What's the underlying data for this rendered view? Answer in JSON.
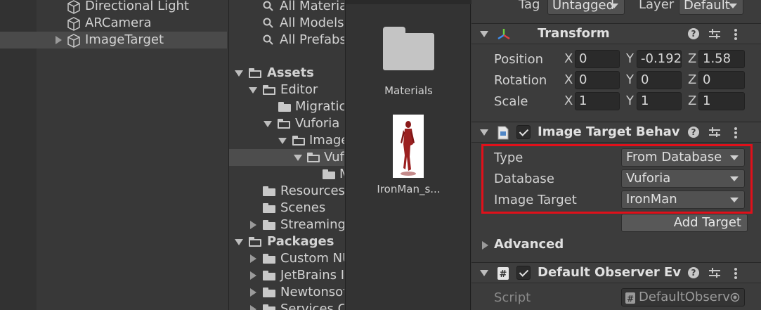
{
  "hierarchy": {
    "items": [
      {
        "label": "Directional Light"
      },
      {
        "label": "ARCamera"
      },
      {
        "label": "ImageTarget"
      }
    ]
  },
  "project": {
    "search_items": [
      "All Materia",
      "All Models",
      "All Prefabs"
    ],
    "tree": [
      {
        "label": "Assets"
      },
      {
        "label": "Editor"
      },
      {
        "label": "Migratic"
      },
      {
        "label": "Vuforia"
      },
      {
        "label": "Image"
      },
      {
        "label": "Vuf"
      },
      {
        "label": "M"
      },
      {
        "label": "Resources"
      },
      {
        "label": "Scenes"
      },
      {
        "label": "Streaming."
      },
      {
        "label": "Packages"
      },
      {
        "label": "Custom NU"
      },
      {
        "label": "JetBrains I"
      },
      {
        "label": "Newtonsof"
      },
      {
        "label": "Services C"
      }
    ]
  },
  "assets": {
    "items": [
      {
        "label": "Materials",
        "icon": "folder-icon"
      },
      {
        "label": "IronMan_s...",
        "icon": "image-thumbnail"
      }
    ]
  },
  "inspector": {
    "tag_label": "Tag",
    "tag_value": "Untagged",
    "layer_label": "Layer",
    "layer_value": "Default",
    "transform": {
      "title": "Transform",
      "position_label": "Position",
      "rotation_label": "Rotation",
      "scale_label": "Scale",
      "axis_x": "X",
      "axis_y": "Y",
      "axis_z": "Z",
      "position": {
        "x": "0",
        "y": "-0.192",
        "z": "1.58"
      },
      "rotation": {
        "x": "0",
        "y": "0",
        "z": "0"
      },
      "scale": {
        "x": "1",
        "y": "1",
        "z": "1"
      }
    },
    "image_target": {
      "title": "Image Target Behavio",
      "type_label": "Type",
      "type_value": "From Database",
      "database_label": "Database",
      "database_value": "Vuforia",
      "image_target_label": "Image Target",
      "image_target_value": "IronMan",
      "add_target_label": "Add Target",
      "advanced_label": "Advanced"
    },
    "observer": {
      "title": "Default Observer Ever",
      "script_label": "Script",
      "script_value": "DefaultObserv"
    },
    "help_glyph": "?"
  },
  "colors": {
    "highlight": "#e0101a",
    "panel_bg": "#383838"
  }
}
